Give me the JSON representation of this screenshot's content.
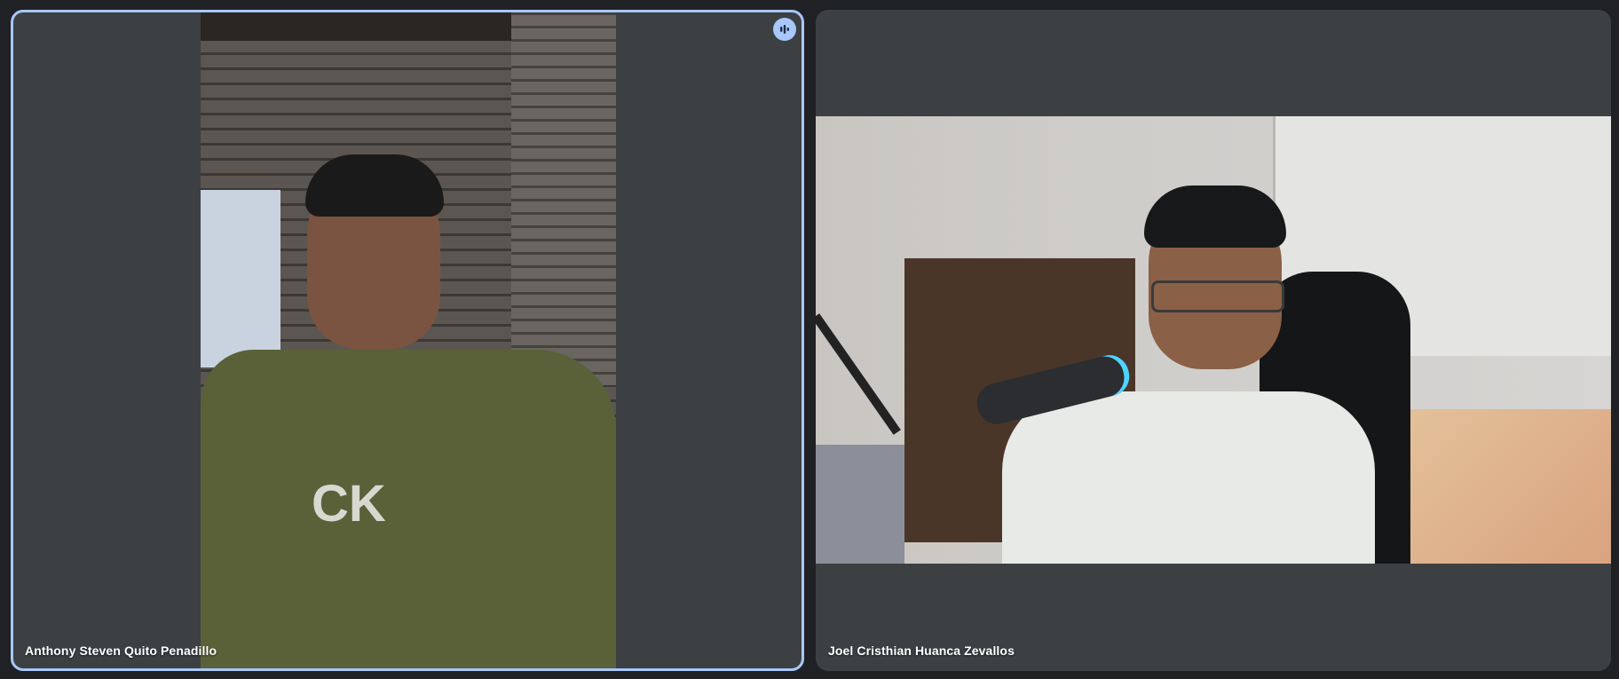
{
  "participants": [
    {
      "name": "Anthony Steven Quito Penadillo",
      "speaking": true,
      "speaking_indicator_icon": "audio-bars-icon",
      "highlight_color": "#a8c7fa"
    },
    {
      "name": "Joel Cristhian Huanca Zevallos",
      "speaking": false
    }
  ],
  "shirt_logo_left": "CK",
  "theme": {
    "background": "#202124",
    "tile_background": "#3c4043",
    "active_border": "#a8c7fa",
    "text": "#ffffff"
  }
}
